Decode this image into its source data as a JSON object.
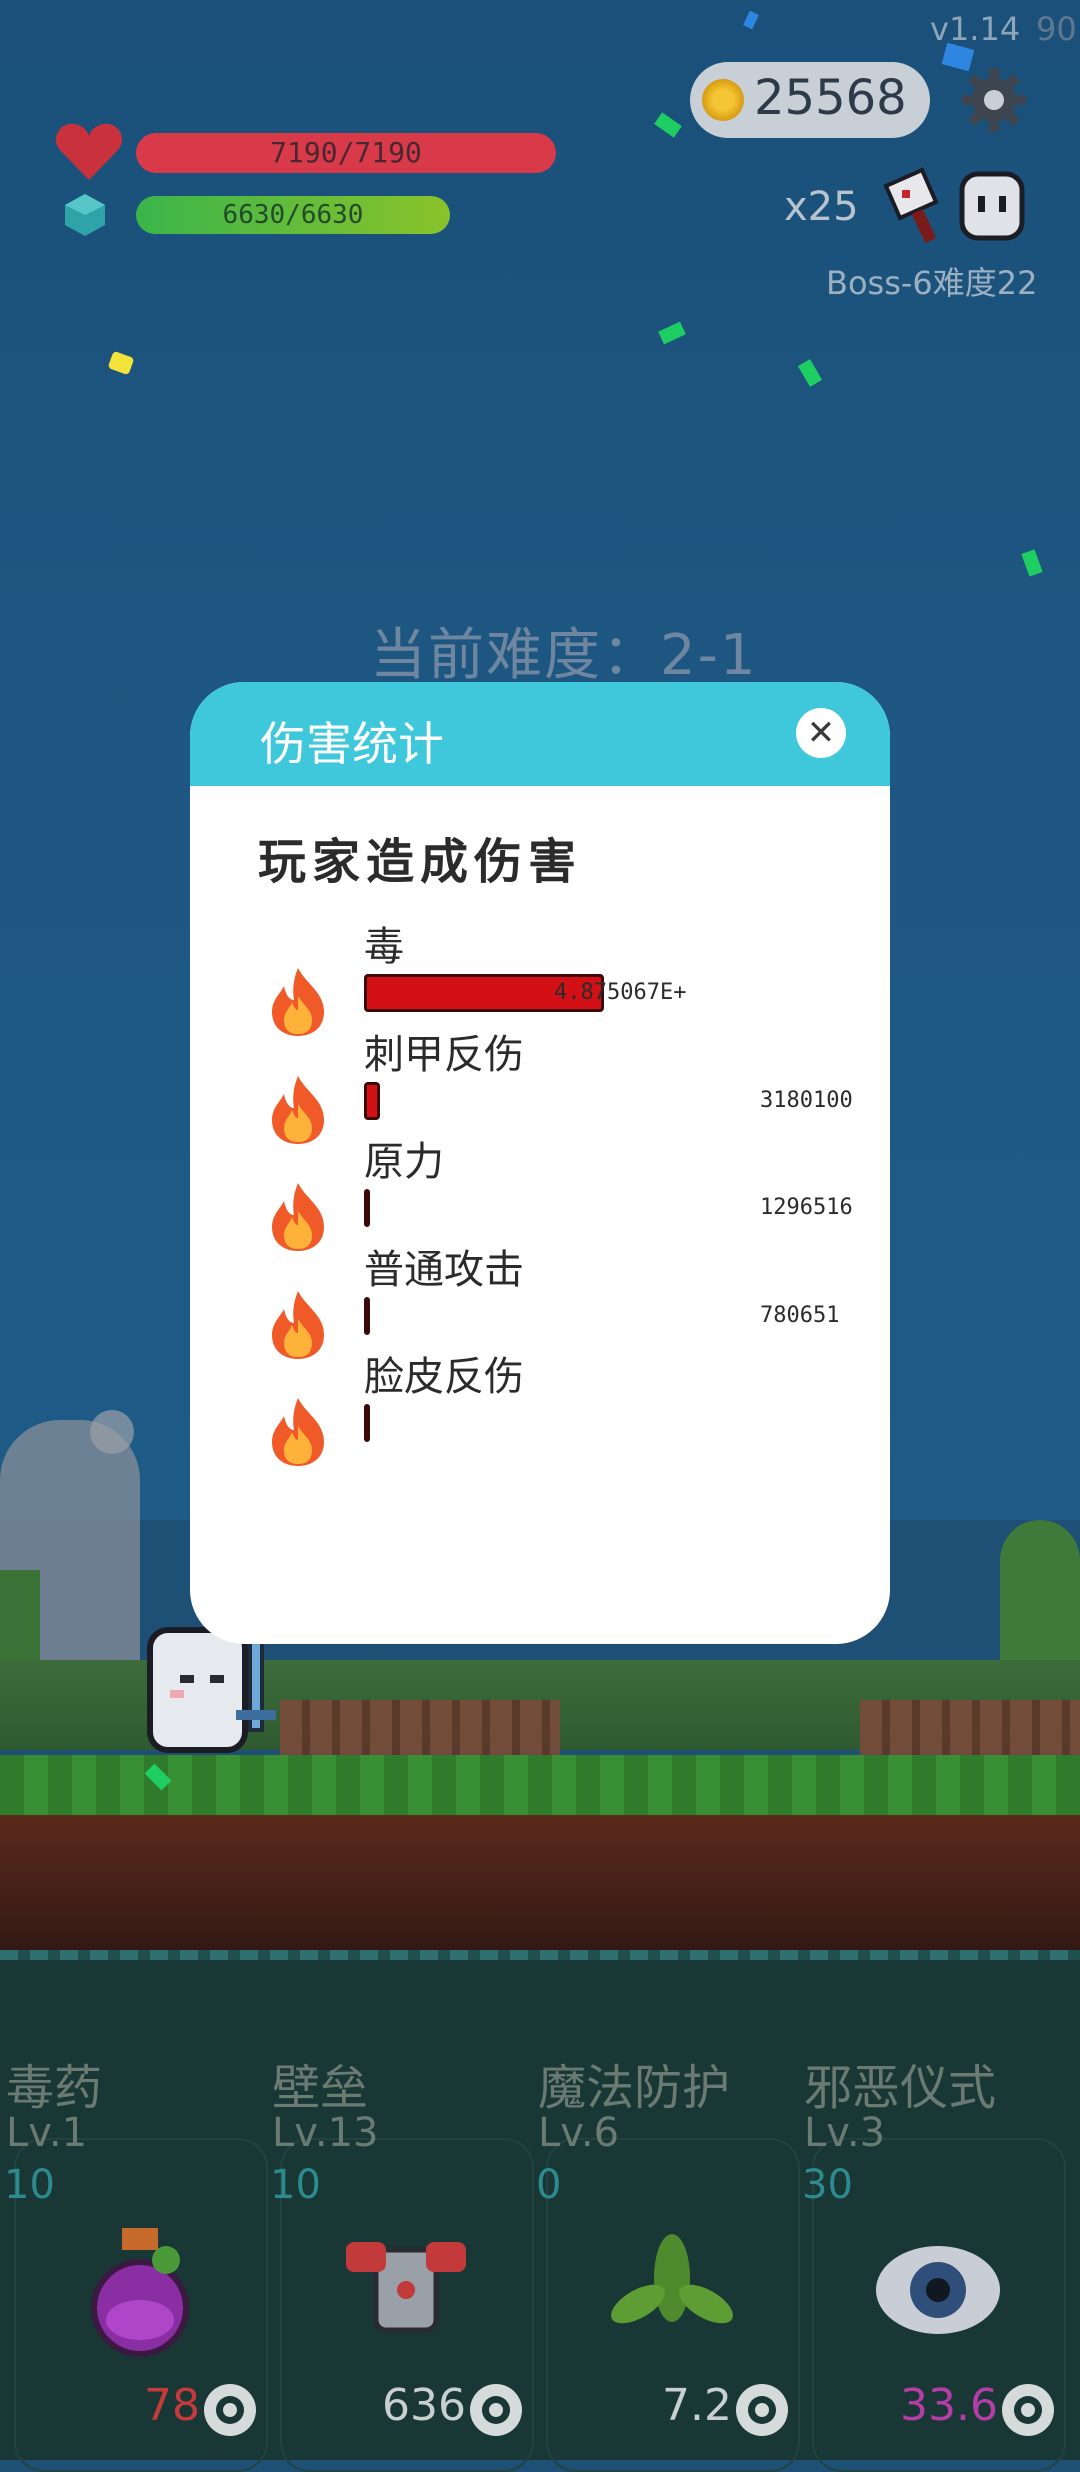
{
  "hud": {
    "version": "v1.14",
    "fps": "90",
    "coins": "25568",
    "hp_text": "7190/7190",
    "mp_text": "6630/6630",
    "multiplier": "x25",
    "boss_label": "Boss-6难度22",
    "difficulty": "当前难度：2-1"
  },
  "modal": {
    "title": "伤害统计",
    "close_label": "✕",
    "section_title": "玩家造成伤害",
    "rows": [
      {
        "name": "毒",
        "value": "4.875067E+",
        "fill": 1.0
      },
      {
        "name": "刺甲反伤",
        "value": "3180100",
        "fill": 0.065
      },
      {
        "name": "原力",
        "value": "1296516",
        "fill": 0.027
      },
      {
        "name": "普通攻击",
        "value": "780651",
        "fill": 0.016
      },
      {
        "name": "脸皮反伤",
        "value": "",
        "fill": 0.01
      }
    ]
  },
  "skills": [
    {
      "name": "毒药",
      "level": "Lv.1",
      "cost": "10",
      "stat": "78",
      "stat_color": "#c53a3a",
      "icon": "potion-icon"
    },
    {
      "name": "壁垒",
      "level": "Lv.13",
      "cost": "10",
      "stat": "636",
      "stat_color": "#c9d0d0",
      "icon": "armor-icon"
    },
    {
      "name": "魔法防护",
      "level": "Lv.6",
      "cost": "0",
      "stat": "7.2",
      "stat_color": "#c9d0d0",
      "icon": "leaf-icon"
    },
    {
      "name": "邪恶仪式",
      "level": "Lv.3",
      "cost": "30",
      "stat": "33.6",
      "stat_color": "#b53da8",
      "icon": "eye-icon"
    }
  ],
  "colors": {
    "modal_header": "#3fc7dc",
    "damage_bar": "#d21016",
    "hp_bar": "#d83a4a",
    "mp_bar": "#3ab54a"
  }
}
